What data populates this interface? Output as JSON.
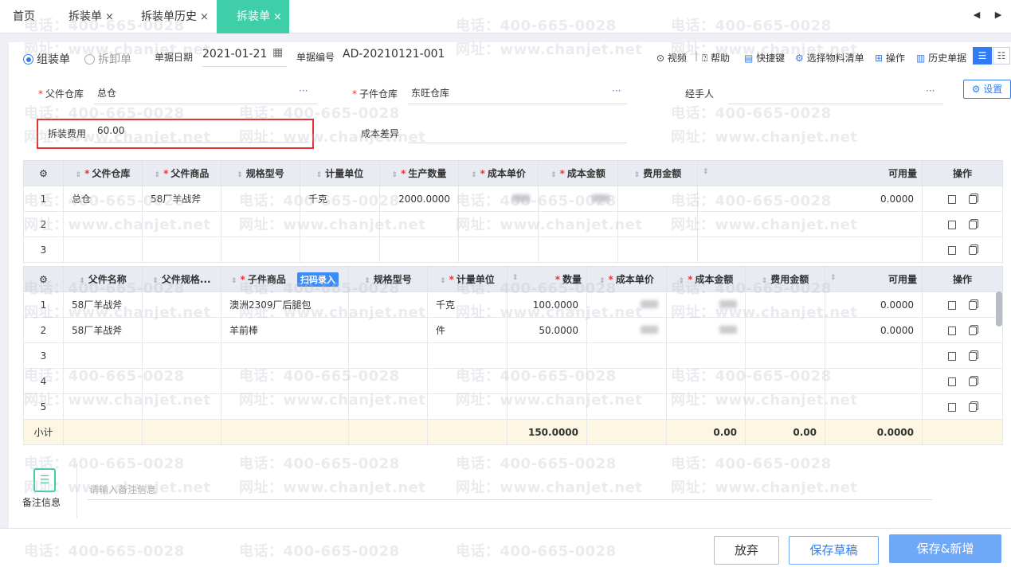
{
  "tabs": [
    {
      "label": "首页",
      "closable": false,
      "active": false
    },
    {
      "label": "拆装单",
      "closable": true,
      "active": false
    },
    {
      "label": "拆装单历史",
      "closable": true,
      "active": false
    },
    {
      "label": "拆装单",
      "closable": true,
      "active": true
    }
  ],
  "close_glyph": "×",
  "nav": {
    "prev": "◀",
    "next": "▶"
  },
  "header": {
    "mode_assemble": "组装单",
    "mode_disassemble": "拆卸单",
    "date_label": "单据日期",
    "date_value": "2021-01-21",
    "number_label": "单据编号",
    "number_value": "AD-20210121-001"
  },
  "toolbar": {
    "video": "视频",
    "help": "帮助",
    "shortcut": "快捷键",
    "select_bom": "选择物料清单",
    "operation": "操作",
    "history": "历史单据",
    "settings": "设置"
  },
  "form": {
    "parent_wh_label": "父件仓库",
    "parent_wh_value": "总仓",
    "child_wh_label": "子件仓库",
    "child_wh_value": "东旺仓库",
    "handler_label": "经手人",
    "handler_value": "",
    "fee_label": "拆装费用",
    "fee_value": "60.00",
    "cost_diff_label": "成本差异",
    "more": "···"
  },
  "parent_table": {
    "headers": [
      "父件仓库",
      "父件商品",
      "规格型号",
      "计量单位",
      "生产数量",
      "成本单价",
      "成本金额",
      "费用金额",
      "可用量",
      "操作"
    ],
    "rows": [
      {
        "idx": "1",
        "wh": "总仓",
        "product": "58厂羊战斧",
        "spec": "",
        "unit": "千克",
        "qty": "2000.0000",
        "avail": "0.0000"
      },
      {
        "idx": "2",
        "wh": "",
        "product": "",
        "spec": "",
        "unit": "",
        "qty": "",
        "avail": ""
      },
      {
        "idx": "3",
        "wh": "",
        "product": "",
        "spec": "",
        "unit": "",
        "qty": "",
        "avail": ""
      }
    ]
  },
  "child_table": {
    "headers": [
      "父件名称",
      "父件规格...",
      "子件商品",
      "规格型号",
      "计量单位",
      "数量",
      "成本单价",
      "成本金额",
      "费用金额",
      "可用量",
      "操作"
    ],
    "scan_badge": "扫码录入",
    "rows": [
      {
        "idx": "1",
        "parent": "58厂羊战斧",
        "product": "澳洲2309厂后腿包",
        "unit": "千克",
        "qty": "100.0000",
        "avail": "0.0000"
      },
      {
        "idx": "2",
        "parent": "58厂羊战斧",
        "product": "羊前棒",
        "unit": "件",
        "qty": "50.0000",
        "avail": "0.0000"
      },
      {
        "idx": "3",
        "parent": "",
        "product": "",
        "unit": "",
        "qty": "",
        "avail": ""
      },
      {
        "idx": "4",
        "parent": "",
        "product": "",
        "unit": "",
        "qty": "",
        "avail": ""
      },
      {
        "idx": "5",
        "parent": "",
        "product": "",
        "unit": "",
        "qty": "",
        "avail": ""
      }
    ],
    "subtotal": {
      "label": "小计",
      "qty": "150.0000",
      "cost_amount": "0.00",
      "fee_amount": "0.00",
      "avail": "0.0000"
    }
  },
  "remarks": {
    "label": "备注信息",
    "placeholder": "请输入备注信息"
  },
  "footer": {
    "discard": "放弃",
    "save_draft": "保存草稿",
    "save_new": "保存&新增"
  },
  "watermark": {
    "phone": "电话：400-665-0028",
    "site": "网址：www.chanjet.net"
  },
  "colors": {
    "accent_tab": "#3fcfa8",
    "primary": "#2f7cf6",
    "primary_btn": "#6fa8f7",
    "required": "#e33333",
    "highlight_border": "#e33333",
    "subtotal_bg": "#fdf6e3"
  }
}
